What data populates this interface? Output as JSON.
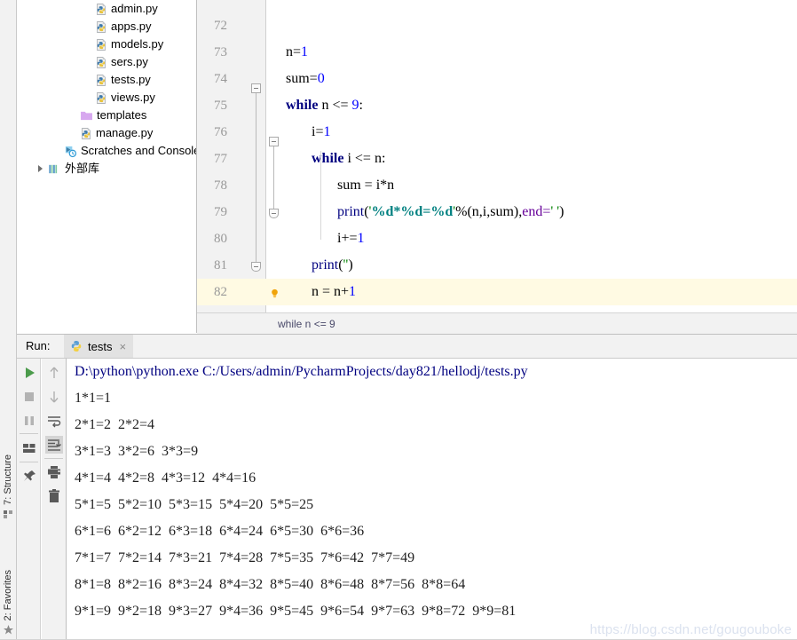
{
  "left_strip": {
    "structure_label": "7: Structure",
    "favorites_label": "2: Favorites"
  },
  "project_tree": {
    "items": [
      {
        "label": "admin.py",
        "icon": "python-file-icon",
        "indent": 88,
        "arrow": false
      },
      {
        "label": "apps.py",
        "icon": "python-file-icon",
        "indent": 88,
        "arrow": false
      },
      {
        "label": "models.py",
        "icon": "python-file-icon",
        "indent": 88,
        "arrow": false
      },
      {
        "label": "sers.py",
        "icon": "python-file-icon",
        "indent": 88,
        "arrow": false
      },
      {
        "label": "tests.py",
        "icon": "python-file-icon",
        "indent": 88,
        "arrow": false
      },
      {
        "label": "views.py",
        "icon": "python-file-icon",
        "indent": 88,
        "arrow": false
      },
      {
        "label": "templates",
        "icon": "folder-icon",
        "indent": 71,
        "arrow": false
      },
      {
        "label": "manage.py",
        "icon": "python-file-icon",
        "indent": 71,
        "arrow": false
      },
      {
        "label": "Scratches and Consoles",
        "icon": "scratches-icon",
        "indent": 53,
        "arrow": false
      },
      {
        "label": "外部库",
        "icon": "library-icon",
        "indent": 35,
        "arrow": true
      }
    ]
  },
  "editor": {
    "lines": [
      {
        "num": "72",
        "tokens": []
      },
      {
        "num": "73",
        "tokens": [
          {
            "t": "n=",
            "c": "plain"
          },
          {
            "t": "1",
            "c": "num"
          }
        ],
        "indent": 0
      },
      {
        "num": "74",
        "tokens": [
          {
            "t": "sum=",
            "c": "plain"
          },
          {
            "t": "0",
            "c": "num"
          }
        ],
        "indent": 0
      },
      {
        "num": "75",
        "tokens": [
          {
            "t": "while",
            "c": "kw"
          },
          {
            "t": " n ",
            "c": "plain"
          },
          {
            "t": "<=",
            "c": "plain"
          },
          {
            "t": " ",
            "c": "plain"
          },
          {
            "t": "9",
            "c": "num"
          },
          {
            "t": ":",
            "c": "plain"
          }
        ],
        "indent": 0
      },
      {
        "num": "76",
        "tokens": [
          {
            "t": "i=",
            "c": "plain"
          },
          {
            "t": "1",
            "c": "num"
          }
        ],
        "indent": 1
      },
      {
        "num": "77",
        "tokens": [
          {
            "t": "while",
            "c": "kw"
          },
          {
            "t": " i ",
            "c": "plain"
          },
          {
            "t": "<=",
            "c": "plain"
          },
          {
            "t": " n:",
            "c": "plain"
          }
        ],
        "indent": 1
      },
      {
        "num": "78",
        "tokens": [
          {
            "t": "sum = i*n",
            "c": "plain"
          }
        ],
        "indent": 2
      },
      {
        "num": "79",
        "tokens": [
          {
            "t": "print",
            "c": "fn"
          },
          {
            "t": "(",
            "c": "plain"
          },
          {
            "t": "'",
            "c": "str"
          },
          {
            "t": "%d*%d=%d",
            "c": "strfmt"
          },
          {
            "t": "'",
            "c": "str"
          },
          {
            "t": "%(n,i,sum),",
            "c": "plain"
          },
          {
            "t": "end=",
            "c": "named"
          },
          {
            "t": "' '",
            "c": "str"
          },
          {
            "t": ")",
            "c": "plain"
          }
        ],
        "indent": 2
      },
      {
        "num": "80",
        "tokens": [
          {
            "t": "i+=",
            "c": "plain"
          },
          {
            "t": "1",
            "c": "num"
          }
        ],
        "indent": 2
      },
      {
        "num": "81",
        "tokens": [
          {
            "t": "print",
            "c": "fn"
          },
          {
            "t": "(",
            "c": "plain"
          },
          {
            "t": "''",
            "c": "str"
          },
          {
            "t": ")",
            "c": "plain"
          }
        ],
        "indent": 1
      },
      {
        "num": "82",
        "tokens": [
          {
            "t": "n = n+",
            "c": "plain"
          },
          {
            "t": "1",
            "c": "num"
          }
        ],
        "indent": 1,
        "highlight": true,
        "bulb": true
      }
    ],
    "breadcrumb": "while n <= 9"
  },
  "run_panel": {
    "label": "Run:",
    "tab_name": "tests",
    "tab_close": "×",
    "toolbar_left": [
      {
        "name": "run-button",
        "glyph": "play"
      },
      {
        "name": "stop-button",
        "glyph": "stop"
      },
      {
        "name": "pause-button",
        "glyph": "pause"
      },
      {
        "name": "layout-button",
        "glyph": "layout"
      },
      {
        "name": "pin-button",
        "glyph": "pin"
      }
    ],
    "toolbar_right": [
      {
        "name": "scroll-up-button",
        "glyph": "arrow-up"
      },
      {
        "name": "scroll-down-button",
        "glyph": "arrow-down"
      },
      {
        "name": "soft-wrap-button",
        "glyph": "wrap"
      },
      {
        "name": "scroll-to-end-button",
        "glyph": "scroll-end",
        "selected": true
      },
      {
        "name": "print-button",
        "glyph": "print"
      },
      {
        "name": "clear-all-button",
        "glyph": "trash"
      }
    ],
    "console_lines": [
      {
        "text": "D:\\python\\python.exe C:/Users/admin/PycharmProjects/day821/hellodj/tests.py",
        "kind": "cmd"
      },
      {
        "text": "1*1=1",
        "kind": "out"
      },
      {
        "text": "2*1=2  2*2=4",
        "kind": "out"
      },
      {
        "text": "3*1=3  3*2=6  3*3=9",
        "kind": "out"
      },
      {
        "text": "4*1=4  4*2=8  4*3=12  4*4=16",
        "kind": "out"
      },
      {
        "text": "5*1=5  5*2=10  5*3=15  5*4=20  5*5=25",
        "kind": "out"
      },
      {
        "text": "6*1=6  6*2=12  6*3=18  6*4=24  6*5=30  6*6=36",
        "kind": "out"
      },
      {
        "text": "7*1=7  7*2=14  7*3=21  7*4=28  7*5=35  7*6=42  7*7=49",
        "kind": "out"
      },
      {
        "text": "8*1=8  8*2=16  8*3=24  8*4=32  8*5=40  8*6=48  8*7=56  8*8=64",
        "kind": "out"
      },
      {
        "text": "9*1=9  9*2=18  9*3=27  9*4=36  9*5=45  9*6=54  9*7=63  9*8=72  9*9=81",
        "kind": "out"
      }
    ]
  },
  "watermark": "https://blog.csdn.net/gougouboke",
  "colors": {
    "keyword": "#000080",
    "number": "#0000ff",
    "string": "#008000",
    "string_format": "#008080",
    "named_arg": "#660099",
    "highlight_row": "#fffae3",
    "panel_bg": "#f2f2f2",
    "run_green": "#4b9b4b",
    "bulb_orange": "#f0a30a"
  }
}
